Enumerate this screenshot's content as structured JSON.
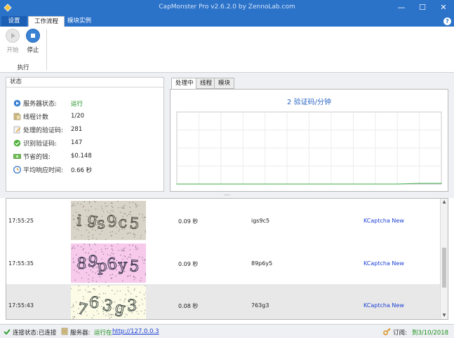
{
  "window": {
    "title": "CapMonster Pro v2.6.2.0 by ZennoLab.com",
    "controls": {
      "minimize": "—",
      "maximize": "☐",
      "close": "✕"
    }
  },
  "ribbon_tabs": {
    "file": "设置",
    "active": "工作流程",
    "other": "模块实例"
  },
  "ribbon": {
    "start_label": "开始",
    "stop_label": "停止",
    "group_label": "执行"
  },
  "status_panel": {
    "header": "状态",
    "rows": [
      {
        "label": "服务器状态:",
        "value": "运行",
        "icon": "server-status-icon"
      },
      {
        "label": "线程计数",
        "value": "1/20",
        "icon": "threads-icon"
      },
      {
        "label": "处理的验证码:",
        "value": "281",
        "icon": "processed-icon"
      },
      {
        "label": "识别验证码:",
        "value": "147",
        "icon": "check-icon"
      },
      {
        "label": "节省的钱:",
        "value": "$0.148",
        "icon": "money-icon"
      },
      {
        "label": "平均响应时间:",
        "value": "0.66 秒",
        "icon": "clock-icon"
      }
    ]
  },
  "chart_tabs": [
    "处理中",
    "线程",
    "模块"
  ],
  "chart_data": {
    "type": "line",
    "title": "2 验证码/分钟",
    "x": [
      0,
      1,
      2,
      3,
      4,
      5,
      6,
      7,
      8,
      9,
      10,
      11,
      12
    ],
    "series": [
      {
        "values": [
          0,
          0,
          0,
          0,
          0,
          0,
          0,
          0,
          0,
          0,
          0,
          0.2,
          0.2
        ]
      }
    ],
    "ylim": [
      0,
      20
    ],
    "grid": true,
    "xlabel": "",
    "ylabel": ""
  },
  "splitter_glyph": "....",
  "captcha_rows": [
    {
      "time": "17:55:25",
      "duration": "0.09 秒",
      "answer": "igs9c5",
      "module": "KCaptcha New",
      "bg": "#d9d4c8",
      "ink": "#555048"
    },
    {
      "time": "17:55:35",
      "duration": "0.09 秒",
      "answer": "89p6y5",
      "module": "KCaptcha New",
      "bg": "#f7c9ea",
      "ink": "#3a3550"
    },
    {
      "time": "17:55:43",
      "duration": "0.08 秒",
      "answer": "763g3",
      "module": "KCaptcha New",
      "bg": "#fbfbe6",
      "ink": "#46504a"
    }
  ],
  "statusbar": {
    "connection": "连接状态:已连接",
    "server_label": "服务器:",
    "server_state": "运行在",
    "server_url": "http://127.0.0.3",
    "subscription_label": "订阅:",
    "subscription_value": "到3/10/2018"
  },
  "colors": {
    "accent": "#2b72c9",
    "green": "#1a8f1a",
    "link": "#1a3fd6"
  }
}
